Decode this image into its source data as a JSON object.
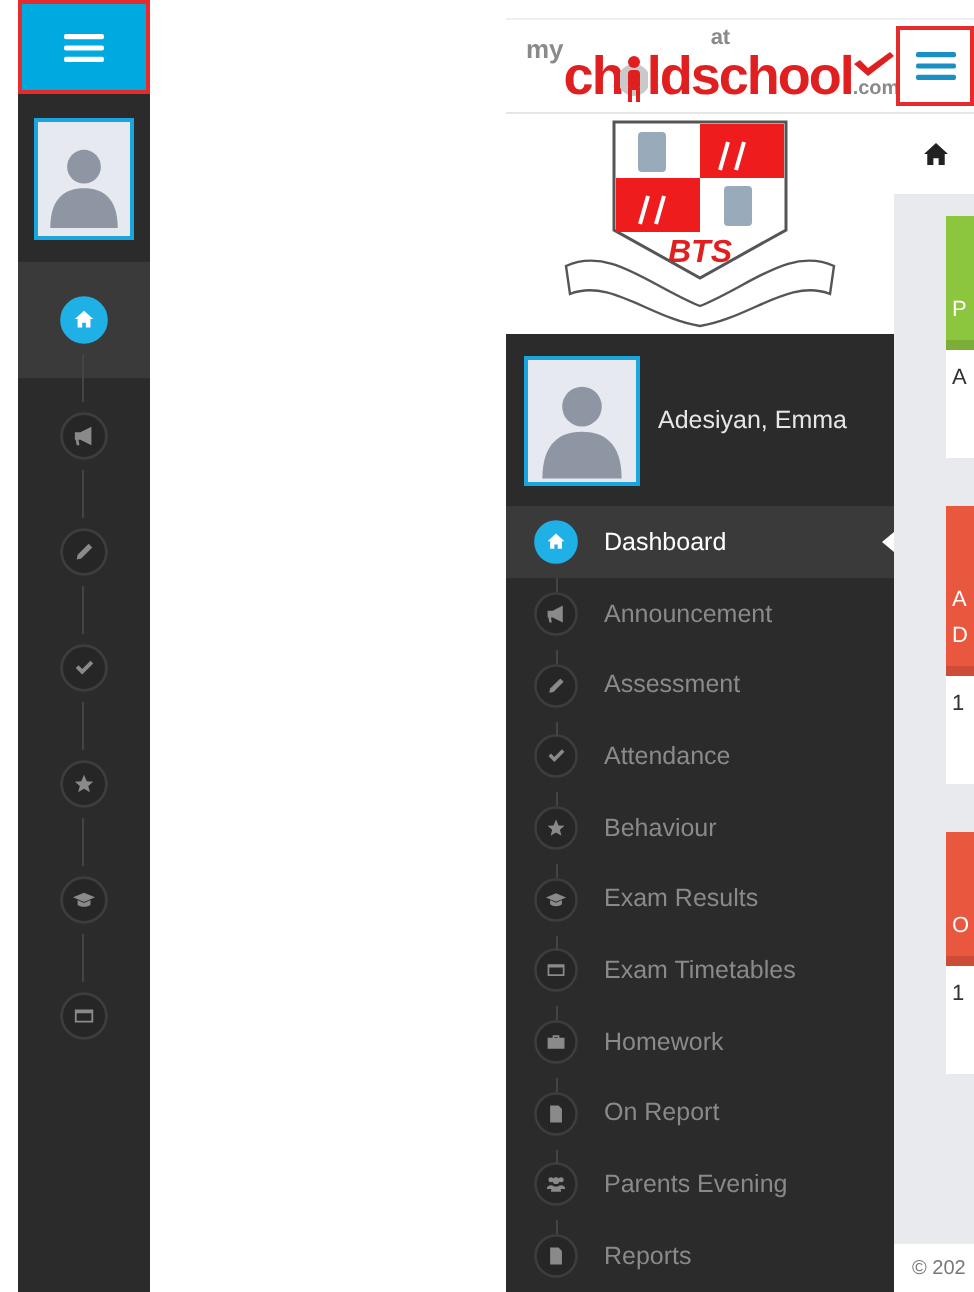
{
  "collapsed_view": {
    "nav": [
      {
        "kind": "home",
        "selected": true
      },
      {
        "kind": "megaphone",
        "selected": false
      },
      {
        "kind": "pencil",
        "selected": false
      },
      {
        "kind": "check",
        "selected": false
      },
      {
        "kind": "star",
        "selected": false
      },
      {
        "kind": "cap",
        "selected": false
      },
      {
        "kind": "card",
        "selected": false
      }
    ]
  },
  "expanded_view": {
    "logo": {
      "parts": [
        "my",
        "ch",
        "ld",
        "at",
        "school",
        ".com"
      ]
    },
    "crest": {
      "initials": "BTS"
    },
    "profile": {
      "name": "Adesiyan, Emma"
    },
    "nav": [
      {
        "kind": "home",
        "label": "Dashboard",
        "selected": true
      },
      {
        "kind": "megaphone",
        "label": "Announcement",
        "selected": false
      },
      {
        "kind": "pencil",
        "label": "Assessment",
        "selected": false
      },
      {
        "kind": "check",
        "label": "Attendance",
        "selected": false
      },
      {
        "kind": "star",
        "label": "Behaviour",
        "selected": false
      },
      {
        "kind": "cap",
        "label": "Exam Results",
        "selected": false
      },
      {
        "kind": "card",
        "label": "Exam Timetables",
        "selected": false
      },
      {
        "kind": "briefcase",
        "label": "Homework",
        "selected": false
      },
      {
        "kind": "file",
        "label": "On Report",
        "selected": false
      },
      {
        "kind": "people",
        "label": "Parents Evening",
        "selected": false
      },
      {
        "kind": "file",
        "label": "Reports",
        "selected": false
      }
    ],
    "cards": [
      {
        "color": "#8cc63f",
        "header_lines": [
          "P"
        ],
        "body": "A"
      },
      {
        "color": "#e9573f",
        "header_lines": [
          "A",
          "D"
        ],
        "body": "1"
      },
      {
        "color": "#e9573f",
        "header_lines": [
          "O"
        ],
        "body": "1"
      }
    ],
    "footer": "© 202"
  }
}
